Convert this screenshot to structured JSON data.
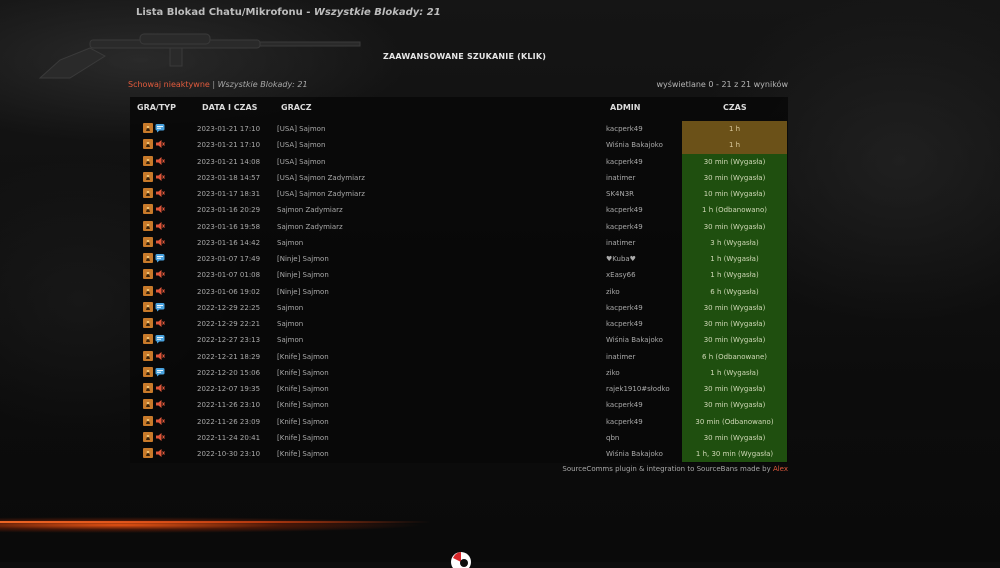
{
  "page": {
    "title": "Lista Blokad Chatu/Mikrofonu",
    "title_sep": " - ",
    "title_count": "Wszystkie Blokady: 21",
    "advanced_search": "ZAAWANSOWANE SZUKANIE (KLIK)",
    "hide_inactive": "Schowaj nieaktywne",
    "filter_sep": " | ",
    "all_blocks": "Wszystkie Blokady: 21",
    "shown_range": "wyświetlane 0 - 21 z 21 wyników"
  },
  "table": {
    "headers": {
      "game": "GRA/TYP",
      "date": "DATA I CZAS",
      "player": "GRACZ",
      "admin": "ADMIN",
      "time": "CZAS"
    },
    "rows": [
      {
        "type": "chat",
        "date": "2023-01-21 17:10",
        "player": "[USA] Sajmon",
        "admin": "kacperk49",
        "time": "1 h",
        "status": "active"
      },
      {
        "type": "mic",
        "date": "2023-01-21 17:10",
        "player": "[USA] Sajmon",
        "admin": "Wiśnia Bakajoko",
        "time": "1 h",
        "status": "active"
      },
      {
        "type": "mic",
        "date": "2023-01-21 14:08",
        "player": "[USA] Sajmon",
        "admin": "kacperk49",
        "time": "30 min (Wygasła)",
        "status": "expired"
      },
      {
        "type": "mic",
        "date": "2023-01-18 14:57",
        "player": "[USA] Sajmon Zadymiarz",
        "admin": "inatimer",
        "time": "30 min (Wygasła)",
        "status": "expired"
      },
      {
        "type": "mic",
        "date": "2023-01-17 18:31",
        "player": "[USA] Sajmon Zadymiarz",
        "admin": "SK4N3R",
        "time": "10 min (Wygasła)",
        "status": "expired"
      },
      {
        "type": "mic",
        "date": "2023-01-16 20:29",
        "player": "Sajmon Zadymiarz",
        "admin": "kacperk49",
        "time": "1 h (Odbanowano)",
        "status": "expired"
      },
      {
        "type": "mic",
        "date": "2023-01-16 19:58",
        "player": "Sajmon Zadymiarz",
        "admin": "kacperk49",
        "time": "30 min (Wygasła)",
        "status": "expired"
      },
      {
        "type": "mic",
        "date": "2023-01-16 14:42",
        "player": "Sajmon",
        "admin": "inatimer",
        "time": "3 h (Wygasła)",
        "status": "expired"
      },
      {
        "type": "chat",
        "date": "2023-01-07 17:49",
        "player": "[Ninje] Sajmon",
        "admin": "♥Kuba♥",
        "time": "1 h (Wygasła)",
        "status": "expired"
      },
      {
        "type": "mic",
        "date": "2023-01-07 01:08",
        "player": "[Ninje] Sajmon",
        "admin": "xEasy66",
        "time": "1 h (Wygasła)",
        "status": "expired"
      },
      {
        "type": "mic",
        "date": "2023-01-06 19:02",
        "player": "[Ninje] Sajmon",
        "admin": "ziko",
        "time": "6 h (Wygasła)",
        "status": "expired"
      },
      {
        "type": "chat",
        "date": "2022-12-29 22:25",
        "player": "Sajmon",
        "admin": "kacperk49",
        "time": "30 min (Wygasła)",
        "status": "expired"
      },
      {
        "type": "mic",
        "date": "2022-12-29 22:21",
        "player": "Sajmon",
        "admin": "kacperk49",
        "time": "30 min (Wygasła)",
        "status": "expired"
      },
      {
        "type": "chat",
        "date": "2022-12-27 23:13",
        "player": "Sajmon",
        "admin": "Wiśnia Bakajoko",
        "time": "30 min (Wygasła)",
        "status": "expired"
      },
      {
        "type": "mic",
        "date": "2022-12-21 18:29",
        "player": "[Knife] Sajmon",
        "admin": "inatimer",
        "time": "6 h (Odbanowane)",
        "status": "expired"
      },
      {
        "type": "chat",
        "date": "2022-12-20 15:06",
        "player": "[Knife] Sajmon",
        "admin": "ziko",
        "time": "1 h (Wygasła)",
        "status": "expired"
      },
      {
        "type": "mic",
        "date": "2022-12-07 19:35",
        "player": "[Knife] Sajmon",
        "admin": "rajek1910#słodko",
        "time": "30 min (Wygasła)",
        "status": "expired"
      },
      {
        "type": "mic",
        "date": "2022-11-26 23:10",
        "player": "[Knife] Sajmon",
        "admin": "kacperk49",
        "time": "30 min (Wygasła)",
        "status": "expired"
      },
      {
        "type": "mic",
        "date": "2022-11-26 23:09",
        "player": "[Knife] Sajmon",
        "admin": "kacperk49",
        "time": "30 min (Odbanowano)",
        "status": "expired"
      },
      {
        "type": "mic",
        "date": "2022-11-24 20:41",
        "player": "[Knife] Sajmon",
        "admin": "qbn",
        "time": "30 min (Wygasła)",
        "status": "expired"
      },
      {
        "type": "mic",
        "date": "2022-10-30 23:10",
        "player": "[Knife] Sajmon",
        "admin": "Wiśnia Bakajoko",
        "time": "1 h, 30 min (Wygasła)",
        "status": "expired"
      }
    ]
  },
  "footer": {
    "credit": "SourceComms plugin & integration to SourceBans made by ",
    "author": "Alex"
  },
  "colors": {
    "active_time": "#6b5118",
    "expired_time": "#1f4f0f",
    "accent": "#e25b3d"
  },
  "icons": {
    "game": "csgo-game-icon",
    "chat": "chat-bubble-icon",
    "mic": "speaker-muted-icon"
  }
}
